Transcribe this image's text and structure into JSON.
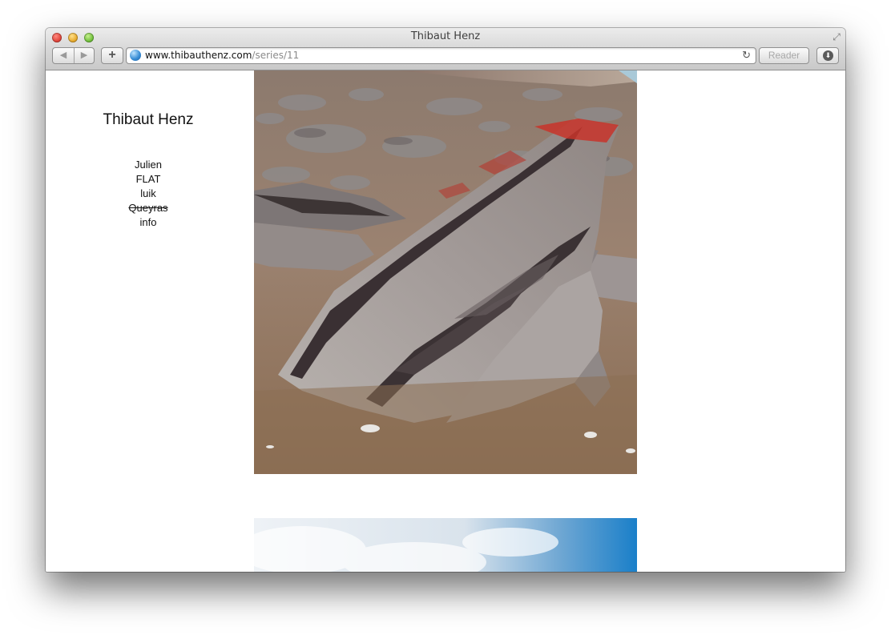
{
  "window": {
    "title": "Thibaut Henz"
  },
  "toolbar": {
    "back_icon": "◀",
    "forward_icon": "▶",
    "add_icon": "+",
    "url_domain": "www.thibauthenz.com",
    "url_path": "/series/11",
    "reload_icon": "↻",
    "reader_label": "Reader",
    "download_icon": "⬇",
    "fullscreen_icon": "⤢"
  },
  "site": {
    "title": "Thibaut Henz",
    "nav": [
      {
        "label": "Julien"
      },
      {
        "label": "FLAT"
      },
      {
        "label": "luik"
      },
      {
        "label": "Queyras",
        "struck": true
      },
      {
        "label": "info"
      }
    ]
  },
  "colors": {
    "accent_sky": "#1a7fc9",
    "rock": "#a19a98",
    "lichen": "#c8342a"
  }
}
